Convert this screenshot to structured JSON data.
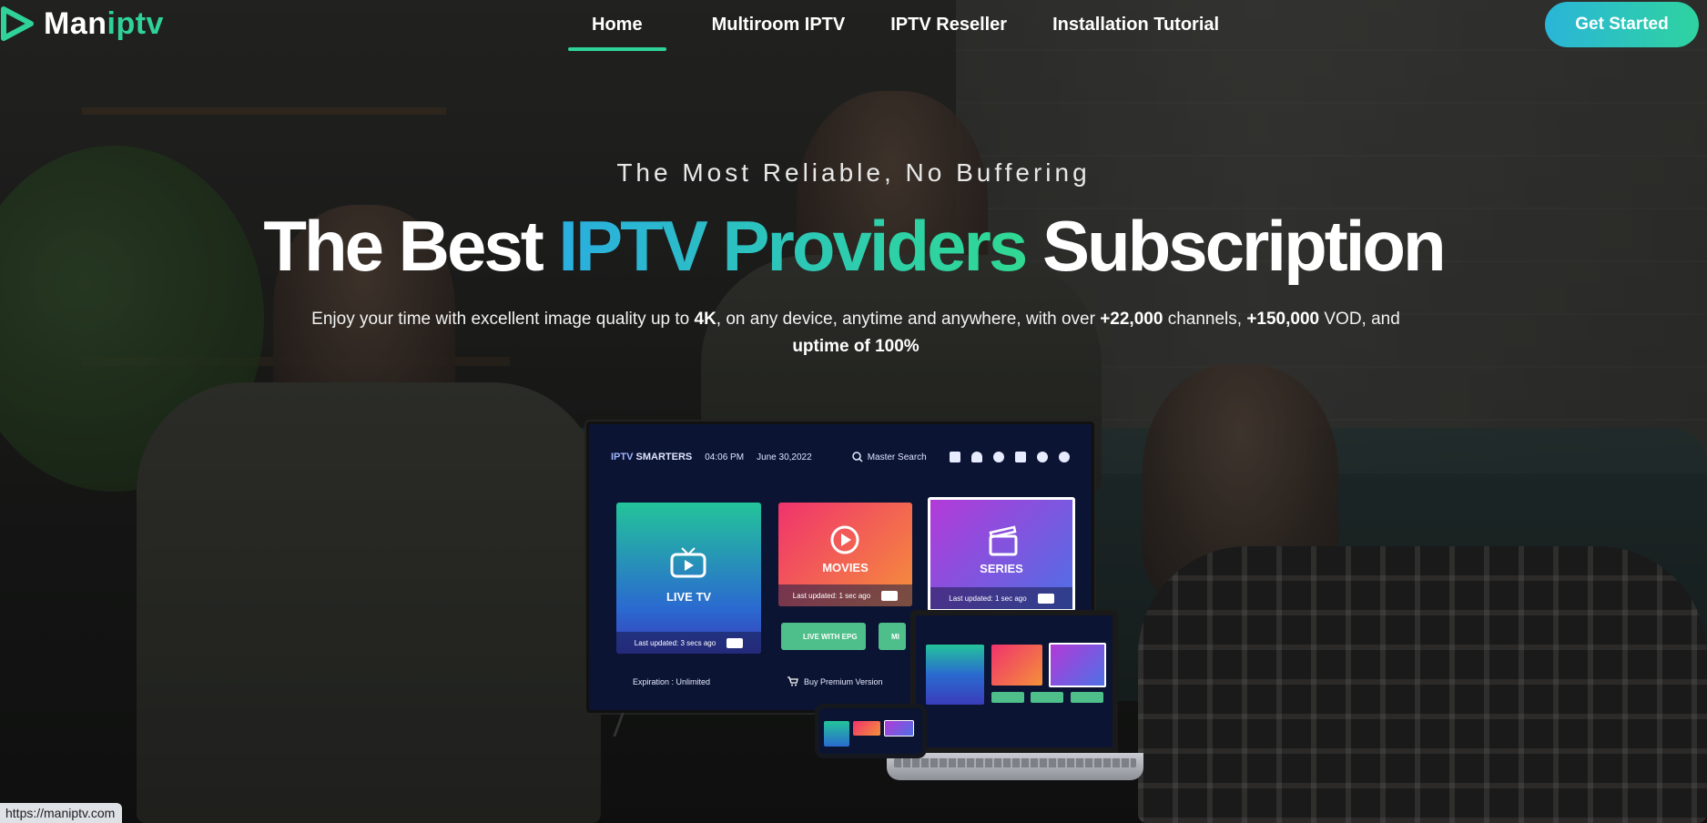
{
  "header": {
    "logo": {
      "part1": "Man",
      "part2": "iptv",
      "accent_color": "#2fd39a"
    },
    "nav": [
      {
        "label": "Home",
        "active": true
      },
      {
        "label": "Multiroom IPTV",
        "active": false
      },
      {
        "label": "IPTV Reseller",
        "active": false
      },
      {
        "label": "Installation Tutorial",
        "active": false
      }
    ],
    "cta_label": "Get Started"
  },
  "hero": {
    "eyebrow": "The Most Reliable, No Buffering",
    "headline": {
      "part1": "The Best ",
      "part2": "IPTV Providers",
      "part3": " Subscription"
    },
    "sub": {
      "t1": "Enjoy your time with excellent image quality up to ",
      "b1": "4K",
      "t2": ", on any device, anytime and anywhere, with over ",
      "b2": "+22,000",
      "t3": " channels, ",
      "b3": "+150,000",
      "t4": " VOD, and",
      "b4": "uptime of 100%"
    }
  },
  "tv_screen": {
    "brand_a": "IPTV",
    "brand_b": "SMARTERS",
    "time": "04:06 PM",
    "date": "June 30,2022",
    "search_label": "Master Search",
    "tiles": {
      "live": {
        "label": "LIVE TV",
        "updated": "Last updated: 3 secs ago"
      },
      "movies": {
        "label": "MOVIES",
        "updated": "Last updated: 1 sec ago"
      },
      "series": {
        "label": "SERIES",
        "updated": "Last updated: 1 sec ago"
      }
    },
    "mini1": "LIVE WITH EPG",
    "mini2": "MI",
    "expiration": "Expiration : Unlimited",
    "buy": "Buy Premium Version"
  },
  "status_bar": {
    "url": "https://maniptv.com"
  },
  "icons": [
    "play-logo-icon",
    "search-icon",
    "bell-icon",
    "user-icon",
    "video-icon",
    "gear-icon",
    "switch-user-icon",
    "tv-icon",
    "play-circle-icon",
    "clapper-icon",
    "refresh-icon",
    "cart-icon"
  ]
}
